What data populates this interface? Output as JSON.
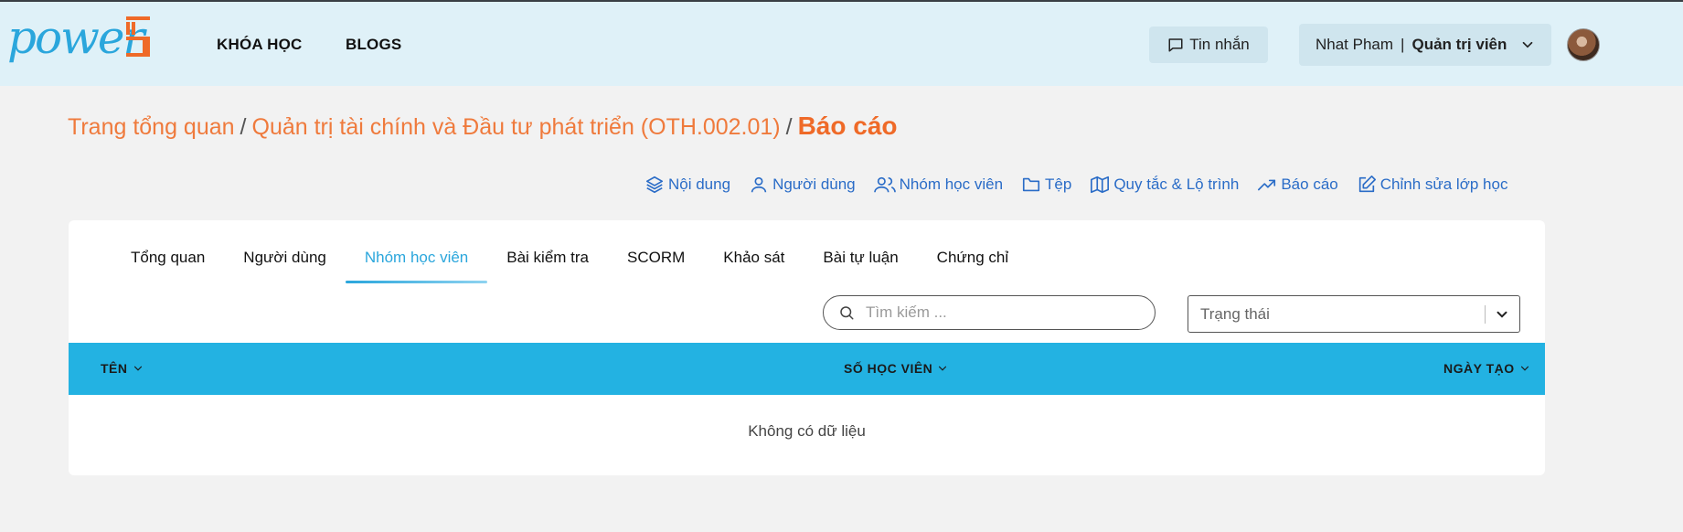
{
  "brand": {
    "logo_text": "power"
  },
  "nav": {
    "courses": "KHÓA HỌC",
    "blogs": "BLOGS"
  },
  "header": {
    "messages_label": "Tin nhắn",
    "user_name": "Nhat Pham",
    "user_separator": "|",
    "user_role": "Quản trị viên"
  },
  "breadcrumb": {
    "items": [
      "Trang tổng quan",
      "Quản trị tài chính và Đầu tư phát triển (OTH.002.01)"
    ],
    "separator": "/",
    "current": "Báo cáo"
  },
  "actions": [
    {
      "label": "Nội dung",
      "icon": "layers-icon"
    },
    {
      "label": "Người dùng",
      "icon": "user-icon"
    },
    {
      "label": "Nhóm học viên",
      "icon": "users-icon"
    },
    {
      "label": "Tệp",
      "icon": "folder-icon"
    },
    {
      "label": "Quy tắc & Lộ trình",
      "icon": "map-icon"
    },
    {
      "label": "Báo cáo",
      "icon": "trending-up-icon"
    },
    {
      "label": "Chỉnh sửa lớp học",
      "icon": "edit-icon"
    }
  ],
  "tabs": [
    {
      "label": "Tổng quan",
      "active": false
    },
    {
      "label": "Người dùng",
      "active": false
    },
    {
      "label": "Nhóm học viên",
      "active": true
    },
    {
      "label": "Bài kiểm tra",
      "active": false
    },
    {
      "label": "SCORM",
      "active": false
    },
    {
      "label": "Khảo sát",
      "active": false
    },
    {
      "label": "Bài tự luận",
      "active": false
    },
    {
      "label": "Chứng chỉ",
      "active": false
    }
  ],
  "search": {
    "placeholder": "Tìm kiếm ..."
  },
  "status_filter": {
    "placeholder": "Trạng thái"
  },
  "table": {
    "columns": [
      "TÊN",
      "SỐ HỌC VIÊN",
      "NGÀY TẠO"
    ],
    "empty_text": "Không có dữ liệu"
  },
  "colors": {
    "accent_orange": "#ef7a3c",
    "accent_blue": "#2aa6dc",
    "header_bg": "#dff1f8",
    "table_header_bg": "#23b2e2",
    "link_blue": "#2a6cc7"
  }
}
